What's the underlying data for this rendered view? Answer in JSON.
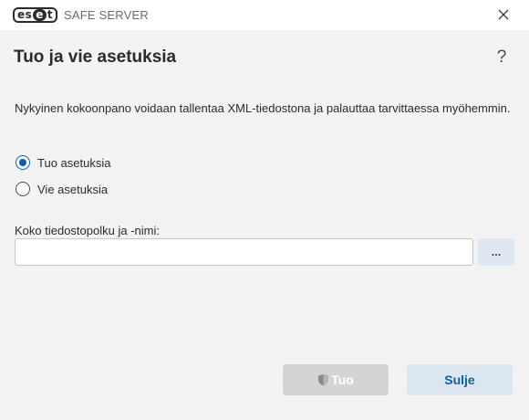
{
  "titlebar": {
    "brand_left": "es",
    "brand_mid": "e",
    "brand_right": "t",
    "product": "SAFE SERVER"
  },
  "dialog": {
    "title": "Tuo ja vie asetuksia",
    "help": "?",
    "description": "Nykyinen kokoonpano voidaan tallentaa XML-tiedostona ja palauttaa tarvittaessa myöhemmin."
  },
  "options": {
    "import_label": "Tuo asetuksia",
    "export_label": "Vie asetuksia",
    "selected": "import"
  },
  "path": {
    "label": "Koko tiedostopolku ja -nimi:",
    "value": "",
    "placeholder": "",
    "browse_label": "..."
  },
  "buttons": {
    "import_label": "Tuo",
    "close_label": "Sulje"
  },
  "colors": {
    "accent": "#0d5ea8",
    "disabled": "#d4d4d4",
    "secondary_bg": "#dbe6f1"
  },
  "icons": {
    "close": "close-icon",
    "help": "help-icon",
    "import_shield": "shield-icon"
  }
}
